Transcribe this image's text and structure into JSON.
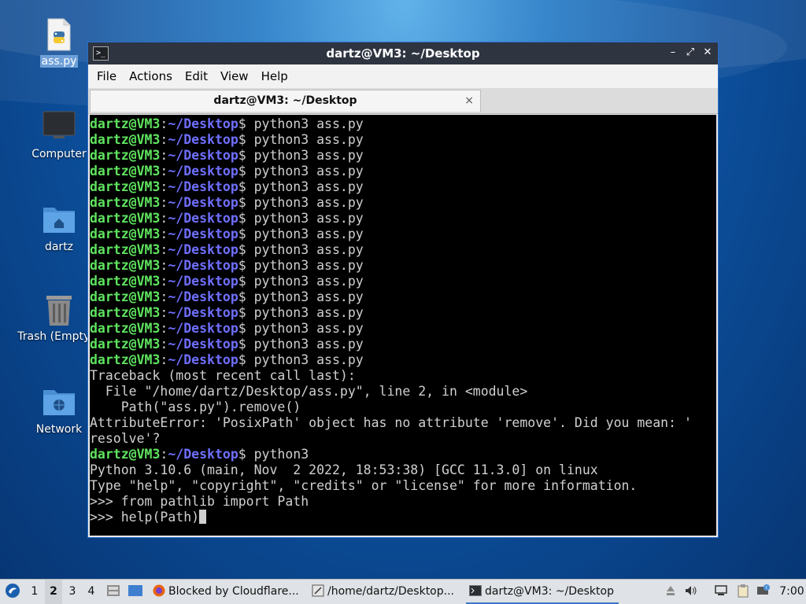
{
  "desktop": {
    "icons": [
      {
        "label": "ass.py"
      },
      {
        "label": "Computer"
      },
      {
        "label": "dartz"
      },
      {
        "label": "Trash (Empty)"
      },
      {
        "label": "Network"
      }
    ]
  },
  "window": {
    "title": "dartz@VM3: ~/Desktop",
    "menu": [
      "File",
      "Actions",
      "Edit",
      "View",
      "Help"
    ],
    "tab_title": "dartz@VM3: ~/Desktop",
    "tab_close": "×",
    "controls": {
      "minimize": "–",
      "maximize": "⤢",
      "close": "✕"
    }
  },
  "terminal": {
    "prompt_user": "dartz@VM3",
    "prompt_sep": ":",
    "prompt_path": "~/Desktop",
    "prompt_dollar": "$ ",
    "repeated_command": "python3 ass.py",
    "repeated_count": 16,
    "traceback": [
      "Traceback (most recent call last):",
      "  File \"/home/dartz/Desktop/ass.py\", line 2, in <module>",
      "    Path(\"ass.py\").remove()",
      "AttributeError: 'PosixPath' object has no attribute 'remove'. Did you mean: '",
      "resolve'?"
    ],
    "second_command": "python3",
    "python_banner": [
      "Python 3.10.6 (main, Nov  2 2022, 18:53:38) [GCC 11.3.0] on linux",
      "Type \"help\", \"copyright\", \"credits\" or \"license\" for more information."
    ],
    "repl_lines": [
      ">>> from pathlib import Path",
      ">>> help(Path)"
    ]
  },
  "taskbar": {
    "workspaces": [
      "1",
      "2",
      "3",
      "4"
    ],
    "active_workspace": "2",
    "tasks": [
      {
        "label": "Blocked by Cloudflare...",
        "icon": "firefox-icon"
      },
      {
        "label": "/home/dartz/Desktop...",
        "icon": "text-editor-icon"
      },
      {
        "label": "dartz@VM3: ~/Desktop",
        "icon": "terminal-icon"
      }
    ],
    "clock": "7:00"
  }
}
